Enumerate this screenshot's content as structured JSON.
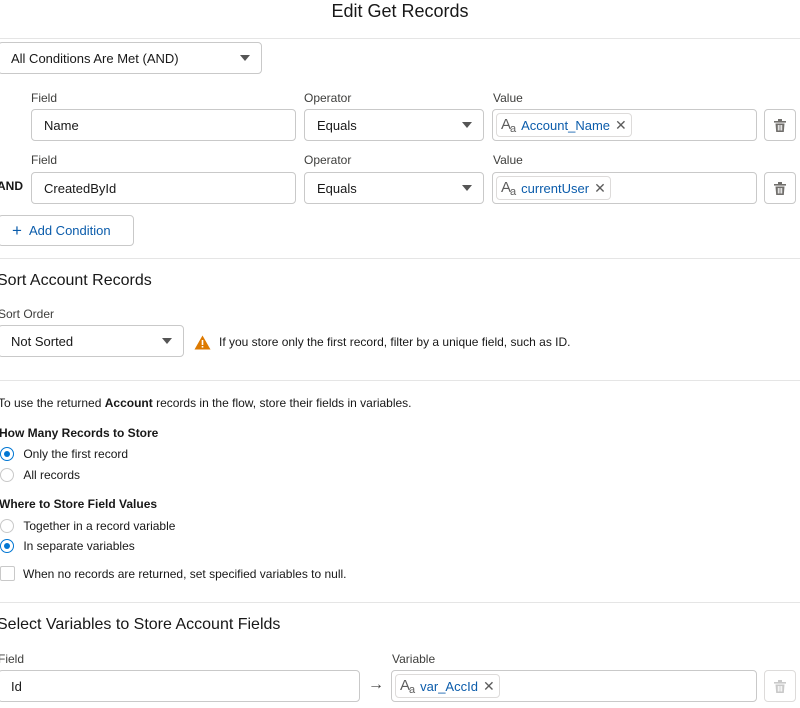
{
  "header": {
    "title": "Edit Get Records"
  },
  "conditions": {
    "logic_value": "All Conditions Are Met (AND)",
    "rows": [
      {
        "prefix": "",
        "field_label": "Field",
        "field_value": "Name",
        "operator_label": "Operator",
        "operator_value": "Equals",
        "value_label": "Value",
        "value_pill": "Account_Name"
      },
      {
        "prefix": "AND",
        "field_label": "Field",
        "field_value": "CreatedById",
        "operator_label": "Operator",
        "operator_value": "Equals",
        "value_label": "Value",
        "value_pill": "currentUser"
      }
    ],
    "add_condition_label": "Add Condition"
  },
  "sort": {
    "heading": "Sort Account Records",
    "order_label": "Sort Order",
    "order_value": "Not Sorted",
    "warning_text": "If you store only the first record, filter by a unique field, such as ID."
  },
  "store": {
    "intro_before": "To use the returned ",
    "intro_bold": "Account",
    "intro_after": " records in the flow, store their fields in variables.",
    "how_many_label": "How Many Records to Store",
    "how_many_options": [
      "Only the first record",
      "All records"
    ],
    "how_many_selected": 0,
    "where_label": "Where to Store Field Values",
    "where_options": [
      "Together in a record variable",
      "In separate variables"
    ],
    "where_selected": 1,
    "null_checkbox_label": "When no records are returned, set specified variables to null.",
    "null_checked": false
  },
  "variables": {
    "heading": "Select Variables to Store Account Fields",
    "field_label": "Field",
    "field_value": "Id",
    "variable_label": "Variable",
    "variable_pill": "var_AccId"
  },
  "icons": {
    "text_type_icon_main": "A",
    "text_type_icon_sub": "a",
    "remove_icon": "✕",
    "plus_icon": "+",
    "arrow_icon": "→",
    "warning_icon": "!"
  },
  "colors": {
    "brand_blue": "#0176d3",
    "link_blue": "#0b5cab",
    "warning_orange": "#dd7a01"
  }
}
